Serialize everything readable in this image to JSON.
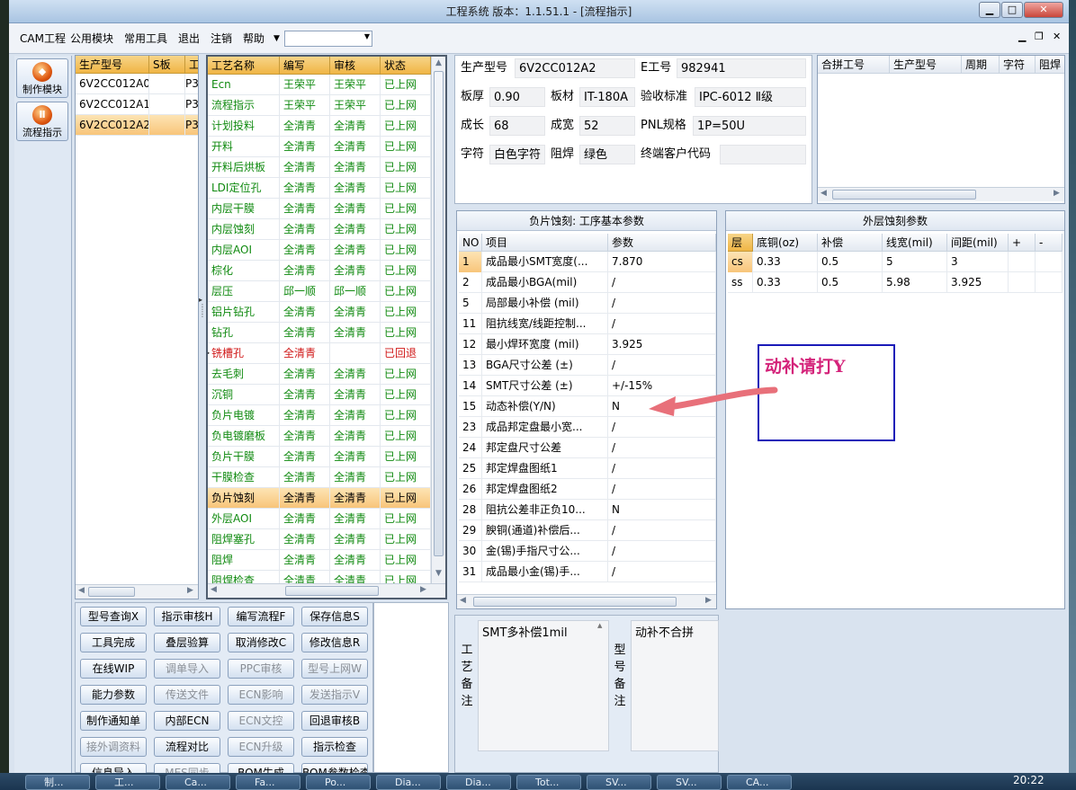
{
  "window": {
    "title": "工程系统   版本：1.1.51.1 - [流程指示]"
  },
  "menu": {
    "items": [
      "CAM工程",
      "公用模块",
      "常用工具",
      "退出",
      "注销",
      "帮助"
    ],
    "dropdown_value": ""
  },
  "nav": {
    "items": [
      {
        "label": "制作模块"
      },
      {
        "label": "流程指示"
      }
    ]
  },
  "models": {
    "headers": [
      "生产型号",
      "S板",
      "工"
    ],
    "rows": [
      {
        "model": "6V2CC012A0",
        "s": "",
        "w": "P3"
      },
      {
        "model": "6V2CC012A1",
        "s": "",
        "w": "P3"
      },
      {
        "model": "6V2CC012A2",
        "s": "",
        "w": "P3"
      }
    ],
    "selected": 2
  },
  "process": {
    "headers": [
      "工艺名称",
      "编写",
      "审核",
      "状态"
    ],
    "rows": [
      {
        "name": "Ecn",
        "author": "王荣平",
        "review": "王荣平",
        "status": "已上网"
      },
      {
        "name": "流程指示",
        "author": "王荣平",
        "review": "王荣平",
        "status": "已上网"
      },
      {
        "name": "计划投料",
        "author": "全清青",
        "review": "全清青",
        "status": "已上网"
      },
      {
        "name": "开料",
        "author": "全清青",
        "review": "全清青",
        "status": "已上网"
      },
      {
        "name": "开料后烘板",
        "author": "全清青",
        "review": "全清青",
        "status": "已上网"
      },
      {
        "name": "LDI定位孔",
        "author": "全清青",
        "review": "全清青",
        "status": "已上网"
      },
      {
        "name": "内层干膜",
        "author": "全清青",
        "review": "全清青",
        "status": "已上网"
      },
      {
        "name": "内层蚀刻",
        "author": "全清青",
        "review": "全清青",
        "status": "已上网"
      },
      {
        "name": "内层AOI",
        "author": "全清青",
        "review": "全清青",
        "status": "已上网"
      },
      {
        "name": "棕化",
        "author": "全清青",
        "review": "全清青",
        "status": "已上网"
      },
      {
        "name": "层压",
        "author": "邱一顺",
        "review": "邱一顺",
        "status": "已上网"
      },
      {
        "name": "铝片钻孔",
        "author": "全清青",
        "review": "全清青",
        "status": "已上网"
      },
      {
        "name": "钻孔",
        "author": "全清青",
        "review": "全清青",
        "status": "已上网"
      },
      {
        "name": "铣槽孔",
        "author": "全清青",
        "review": "",
        "status": "已回退"
      },
      {
        "name": "去毛刺",
        "author": "全清青",
        "review": "全清青",
        "status": "已上网"
      },
      {
        "name": "沉铜",
        "author": "全清青",
        "review": "全清青",
        "status": "已上网"
      },
      {
        "name": "负片电镀",
        "author": "全清青",
        "review": "全清青",
        "status": "已上网"
      },
      {
        "name": "负电镀磨板",
        "author": "全清青",
        "review": "全清青",
        "status": "已上网"
      },
      {
        "name": "负片干膜",
        "author": "全清青",
        "review": "全清青",
        "status": "已上网"
      },
      {
        "name": "干膜检查",
        "author": "全清青",
        "review": "全清青",
        "status": "已上网"
      },
      {
        "name": "负片蚀刻",
        "author": "全清青",
        "review": "全清青",
        "status": "已上网"
      },
      {
        "name": "外层AOI",
        "author": "全清青",
        "review": "全清青",
        "status": "已上网"
      },
      {
        "name": "阻焊塞孔",
        "author": "全清青",
        "review": "全清青",
        "status": "已上网"
      },
      {
        "name": "阻焊",
        "author": "全清青",
        "review": "全清青",
        "status": "已上网"
      },
      {
        "name": "阻焊检查",
        "author": "全清青",
        "review": "全清青",
        "status": "已上网"
      }
    ],
    "selected": 20,
    "returned": 13
  },
  "info": {
    "prod_model_label": "生产型号",
    "prod_model": "6V2CC012A2",
    "engineer_label": "E工号",
    "engineer": "982941",
    "thickness_label": "板厚",
    "thickness": "0.90",
    "material_label": "板材",
    "material": "IT-180A",
    "standard_label": "验收标准",
    "standard": "IPC-6012 Ⅱ级",
    "length_label": "成长",
    "length": "68",
    "width_label": "成宽",
    "width": "52",
    "pnl_label": "PNL规格",
    "pnl": "1P=50U",
    "char_label": "字符",
    "char": "白色字符",
    "mask_label": "阻焊",
    "mask": "绿色",
    "customer_label": "终端客户代码",
    "customer": ""
  },
  "merge": {
    "headers": [
      "合拼工号",
      "生产型号",
      "周期",
      "字符",
      "阻焊"
    ]
  },
  "params": {
    "title": "负片蚀刻: 工序基本参数",
    "headers": [
      "NO",
      "项目",
      "参数"
    ],
    "rows": [
      {
        "no": "1",
        "item": "成品最小SMT宽度(...",
        "value": "7.870"
      },
      {
        "no": "2",
        "item": "成品最小BGA(mil)",
        "value": "/"
      },
      {
        "no": "5",
        "item": "局部最小补偿 (mil)",
        "value": "/"
      },
      {
        "no": "11",
        "item": "阻抗线宽/线距控制...",
        "value": "/"
      },
      {
        "no": "12",
        "item": "最小焊环宽度 (mil)",
        "value": "3.925"
      },
      {
        "no": "13",
        "item": "BGA尺寸公差 (±)",
        "value": "/"
      },
      {
        "no": "14",
        "item": "SMT尺寸公差 (±)",
        "value": "+/-15%"
      },
      {
        "no": "15",
        "item": "动态补偿(Y/N)",
        "value": "N"
      },
      {
        "no": "23",
        "item": "成品邦定盘最小宽...",
        "value": "/"
      },
      {
        "no": "24",
        "item": "邦定盘尺寸公差",
        "value": "/"
      },
      {
        "no": "25",
        "item": "邦定焊盘图纸1",
        "value": "/"
      },
      {
        "no": "26",
        "item": "邦定焊盘图纸2",
        "value": "/"
      },
      {
        "no": "28",
        "item": "阻抗公差非正负10...",
        "value": "N"
      },
      {
        "no": "29",
        "item": "腴铜(通道)补偿后...",
        "value": "/"
      },
      {
        "no": "30",
        "item": "金(锡)手指尺寸公...",
        "value": "/"
      },
      {
        "no": "31",
        "item": "成品最小金(锡)手...",
        "value": "/"
      }
    ]
  },
  "outer": {
    "title": "外层蚀刻参数",
    "headers": [
      "层",
      "底铜(oz)",
      "补偿",
      "线宽(mil)",
      "间距(mil)",
      "+",
      "-"
    ],
    "rows": [
      {
        "layer": "cs",
        "base": "0.33",
        "comp": "0.5",
        "width": "5",
        "space": "3"
      },
      {
        "layer": "ss",
        "base": "0.33",
        "comp": "0.5",
        "width": "5.98",
        "space": "3.925"
      }
    ]
  },
  "annotation": {
    "text": "动补请打Y",
    "color": "#d4237a",
    "box_color": "#1a1ab8",
    "arrow_color": "#e8707a"
  },
  "actions": [
    {
      "label": "型号查询X",
      "enabled": true
    },
    {
      "label": "指示审核H",
      "enabled": true
    },
    {
      "label": "编写流程F",
      "enabled": true
    },
    {
      "label": "保存信息S",
      "enabled": true
    },
    {
      "label": "工具完成",
      "enabled": true
    },
    {
      "label": "叠层验算",
      "enabled": true
    },
    {
      "label": "取消修改C",
      "enabled": true
    },
    {
      "label": "修改信息R",
      "enabled": true
    },
    {
      "label": "在线WIP",
      "enabled": true
    },
    {
      "label": "调单导入",
      "enabled": false
    },
    {
      "label": "PPC审核",
      "enabled": false
    },
    {
      "label": "型号上网W",
      "enabled": false
    },
    {
      "label": "能力参数",
      "enabled": true
    },
    {
      "label": "传送文件",
      "enabled": false
    },
    {
      "label": "ECN影响",
      "enabled": false
    },
    {
      "label": "发送指示V",
      "enabled": false
    },
    {
      "label": "制作通知单",
      "enabled": true
    },
    {
      "label": "内部ECN",
      "enabled": true
    },
    {
      "label": "ECN文控",
      "enabled": false
    },
    {
      "label": "回退审核B",
      "enabled": true
    },
    {
      "label": "接外调资料",
      "enabled": false
    },
    {
      "label": "流程对比",
      "enabled": true
    },
    {
      "label": "ECN升级",
      "enabled": false
    },
    {
      "label": "指示检查",
      "enabled": true
    },
    {
      "label": "信息导入",
      "enabled": true
    },
    {
      "label": "MES同步",
      "enabled": false
    },
    {
      "label": "BOM生成",
      "enabled": true
    },
    {
      "label": "BOM参数检查",
      "enabled": true
    }
  ],
  "memo": {
    "process_label": "工艺备注",
    "process_text": "SMT多补偿1mil",
    "model_label": "型号备注",
    "model_text": "动补不合拼"
  },
  "taskbar": {
    "items": [
      "制...",
      "工...",
      "Ca...",
      "Fa...",
      "Po...",
      "Dia...",
      "Dia...",
      "Tot...",
      "SV...",
      "SV...",
      "CA..."
    ],
    "clock": "20:22"
  }
}
